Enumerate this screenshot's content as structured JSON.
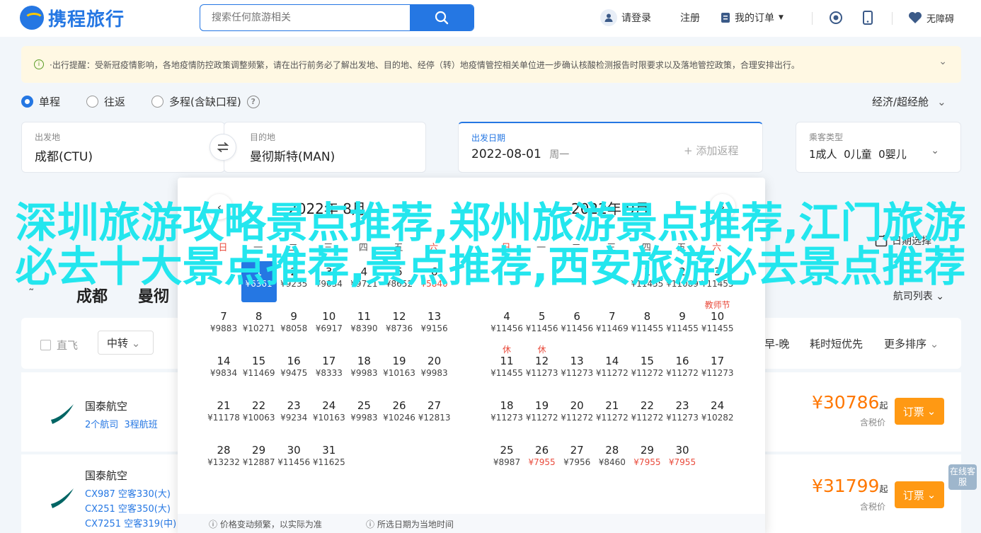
{
  "header": {
    "logo_text": "携程旅行",
    "search_placeholder": "搜索任何旅游相关",
    "login": "请登录",
    "register": "注册",
    "orders": "我的订单",
    "accessibility": "无障碍"
  },
  "notice": {
    "text": "·出行提醒：受新冠疫情影响，各地疫情防控政策调整频繁，请在出行前务必了解出发地、目的地、经停（转）地疫情管控相关单位进一步确认核酸检测报告时限要求以及落地管控政策，合理安排出行。"
  },
  "trip_type": {
    "options": [
      "单程",
      "往返",
      "多程(含缺口程)"
    ],
    "selected": "单程",
    "cabin": "经济/超经舱"
  },
  "search_form": {
    "from_label": "出发地",
    "from_value": "成都(CTU)",
    "to_label": "目的地",
    "to_value": "曼彻斯特(MAN)",
    "date_label": "出发日期",
    "date_value": "2022-08-01",
    "date_weekday": "周一",
    "add_return": "+ 添加返程",
    "pax_label": "乘客类型",
    "pax_value": "1成人  0儿童  0婴儿"
  },
  "calendar": {
    "weekdays": [
      "日",
      "一",
      "二",
      "三",
      "四",
      "五",
      "六"
    ],
    "months": [
      {
        "title": "2022年 8月",
        "weeks": [
          [
            null,
            {
              "d": "1",
              "p": "¥6361",
              "sel": true
            },
            {
              "d": "2",
              "p": "¥9235"
            },
            {
              "d": "3",
              "p": "¥9034"
            },
            {
              "d": "4",
              "p": "¥9721"
            },
            {
              "d": "5",
              "p": "¥8652"
            },
            {
              "d": "6",
              "p": "¥5840",
              "red": true
            }
          ],
          [
            {
              "d": "7",
              "p": "¥9883"
            },
            {
              "d": "8",
              "p": "¥10271"
            },
            {
              "d": "9",
              "p": "¥8058"
            },
            {
              "d": "10",
              "p": "¥6917"
            },
            {
              "d": "11",
              "p": "¥8390"
            },
            {
              "d": "12",
              "p": "¥8736"
            },
            {
              "d": "13",
              "p": "¥9156"
            }
          ],
          [
            {
              "d": "14",
              "p": "¥9834"
            },
            {
              "d": "15",
              "p": "¥11469"
            },
            {
              "d": "16",
              "p": "¥9475"
            },
            {
              "d": "17",
              "p": "¥8333"
            },
            {
              "d": "18",
              "p": "¥9983"
            },
            {
              "d": "19",
              "p": "¥10163"
            },
            {
              "d": "20",
              "p": "¥9983"
            }
          ],
          [
            {
              "d": "21",
              "p": "¥11178"
            },
            {
              "d": "22",
              "p": "¥10063"
            },
            {
              "d": "23",
              "p": "¥9234"
            },
            {
              "d": "24",
              "p": "¥10163"
            },
            {
              "d": "25",
              "p": "¥9983"
            },
            {
              "d": "26",
              "p": "¥10246"
            },
            {
              "d": "27",
              "p": "¥12813"
            }
          ],
          [
            {
              "d": "28",
              "p": "¥13232"
            },
            {
              "d": "29",
              "p": "¥12887"
            },
            {
              "d": "30",
              "p": "¥11456"
            },
            {
              "d": "31",
              "p": "¥11625"
            },
            null,
            null,
            null
          ]
        ]
      },
      {
        "title": "2022年 9月",
        "weeks": [
          [
            null,
            null,
            null,
            null,
            {
              "d": "1",
              "p": "¥11455"
            },
            {
              "d": "2",
              "p": "¥11089"
            },
            {
              "d": "3",
              "p": "¥11455"
            }
          ],
          [
            {
              "d": "4",
              "p": "¥11456"
            },
            {
              "d": "5",
              "p": "¥11456"
            },
            {
              "d": "6",
              "p": "¥11456"
            },
            {
              "d": "7",
              "p": "¥11469"
            },
            {
              "d": "8",
              "p": "¥11455"
            },
            {
              "d": "9",
              "p": "¥11455"
            },
            {
              "d": "10",
              "p": "¥11455",
              "tag": "教师节"
            }
          ],
          [
            {
              "d": "11",
              "p": "¥11455",
              "tag": "休"
            },
            {
              "d": "12",
              "p": "¥11273",
              "tag": "休"
            },
            {
              "d": "13",
              "p": "¥11273"
            },
            {
              "d": "14",
              "p": "¥11272"
            },
            {
              "d": "15",
              "p": "¥11272"
            },
            {
              "d": "16",
              "p": "¥11272"
            },
            {
              "d": "17",
              "p": "¥11273"
            }
          ],
          [
            {
              "d": "18",
              "p": "¥11273"
            },
            {
              "d": "19",
              "p": "¥11272"
            },
            {
              "d": "20",
              "p": "¥11272"
            },
            {
              "d": "21",
              "p": "¥11272"
            },
            {
              "d": "22",
              "p": "¥11272"
            },
            {
              "d": "23",
              "p": "¥11273"
            },
            {
              "d": "24",
              "p": "¥10282"
            }
          ],
          [
            {
              "d": "25",
              "p": "¥8987"
            },
            {
              "d": "26",
              "p": "¥7955",
              "red": true
            },
            {
              "d": "27",
              "p": "¥7956"
            },
            {
              "d": "28",
              "p": "¥8460"
            },
            {
              "d": "29",
              "p": "¥7955",
              "red": true
            },
            {
              "d": "30",
              "p": "¥7955",
              "red": true
            },
            null
          ]
        ]
      }
    ],
    "footer_1": "价格变动频繁，以实际为准",
    "footer_2": "所选日期为当地时间"
  },
  "list": {
    "city_from": "成都",
    "city_to": "曼彻",
    "city_prefix": "˜",
    "airline_table_label": "航司列表",
    "filters": {
      "direct": "直飞",
      "transfer": "中转",
      "time": "早-晚",
      "shortest": "耗时短优先",
      "more": "更多排序",
      "date_pick": "日期选择"
    },
    "flights": [
      {
        "airline": "国泰航空",
        "details": "2个航司  3程航班",
        "price": "30786",
        "from": "起",
        "tax": "含税价",
        "book": "订票"
      },
      {
        "airline": "国泰航空",
        "legs": [
          "CX987 空客330(大)",
          "CX251 空客350(大)",
          "CX7251 空客319(中)"
        ],
        "price": "31799",
        "from": "起",
        "tax": "含税价",
        "book": "订票"
      }
    ],
    "feedback": "在线客服"
  },
  "overlay_text": "深圳旅游攻略景点推荐,郑州旅游景点推荐,江门旅游必去十大景点推荐,景点推荐,西安旅游必去景点推荐",
  "colors": {
    "brand": "#2577e3",
    "accent": "#ff9913",
    "price": "#ff7700",
    "overlay": "#23e6ee"
  }
}
